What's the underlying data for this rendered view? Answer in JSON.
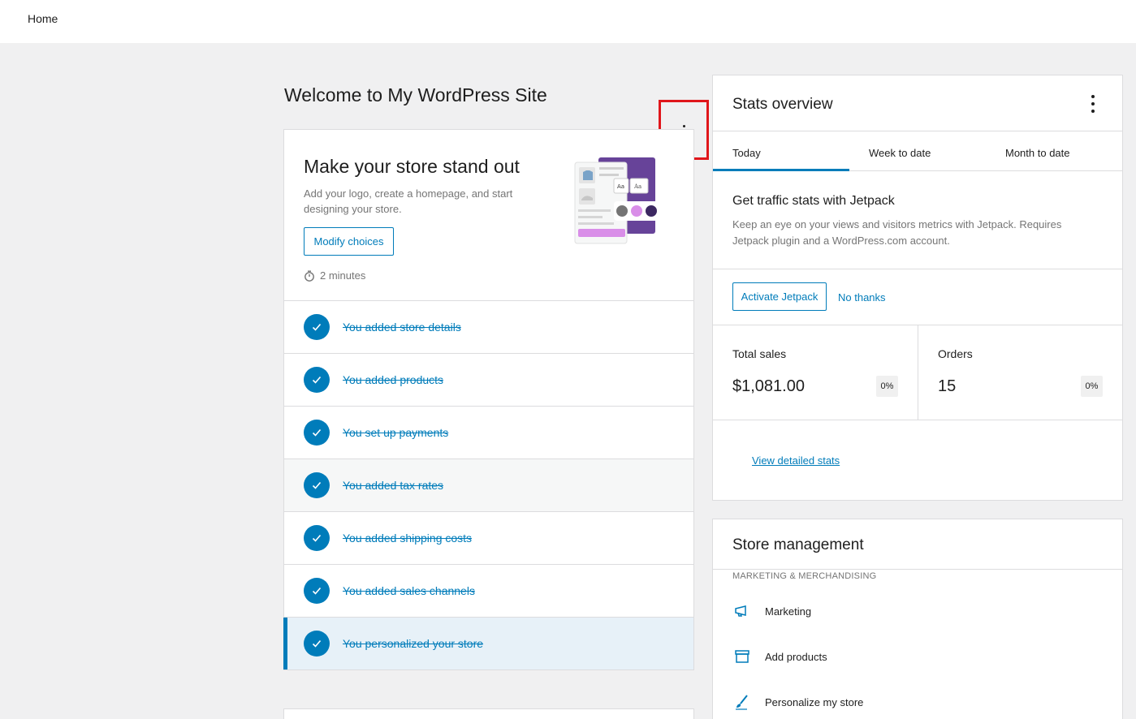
{
  "header": {
    "breadcrumb": "Home"
  },
  "welcome_title": "Welcome to My WordPress Site",
  "setup": {
    "title": "Make your store stand out",
    "description": "Add your logo, create a homepage, and start designing your store.",
    "button": "Modify choices",
    "time": "2 minutes",
    "tasks": [
      {
        "label": "You added store details",
        "icon": "check-icon"
      },
      {
        "label": "You added products",
        "icon": "check-icon"
      },
      {
        "label": "You set up payments",
        "icon": "check-icon"
      },
      {
        "label": "You added tax rates",
        "icon": "check-icon"
      },
      {
        "label": "You added shipping costs",
        "icon": "check-icon"
      },
      {
        "label": "You added sales channels",
        "icon": "check-icon"
      },
      {
        "label": "You personalized your store",
        "icon": "check-icon"
      }
    ]
  },
  "stats": {
    "title": "Stats overview",
    "tabs": [
      "Today",
      "Week to date",
      "Month to date"
    ],
    "selected_tab": "Today",
    "jetpack_title": "Get traffic stats with Jetpack",
    "jetpack_desc": "Keep an eye on your views and visitors metrics with Jetpack. Requires Jetpack plugin and a WordPress.com account.",
    "activate_button": "Activate Jetpack",
    "dismiss_link": "No thanks",
    "metrics": [
      {
        "label": "Total sales",
        "value": "$1,081.00",
        "delta": "0%"
      },
      {
        "label": "Orders",
        "value": "15",
        "delta": "0%"
      }
    ],
    "view_link": "View detailed stats"
  },
  "store_management": {
    "title": "Store management",
    "category": "MARKETING & MERCHANDISING",
    "items": [
      {
        "label": "Marketing",
        "icon": "megaphone-icon"
      },
      {
        "label": "Add products",
        "icon": "archive-icon"
      },
      {
        "label": "Personalize my store",
        "icon": "brush-icon"
      }
    ]
  },
  "colors": {
    "accent": "#007cba",
    "highlight": "#e0161b"
  }
}
